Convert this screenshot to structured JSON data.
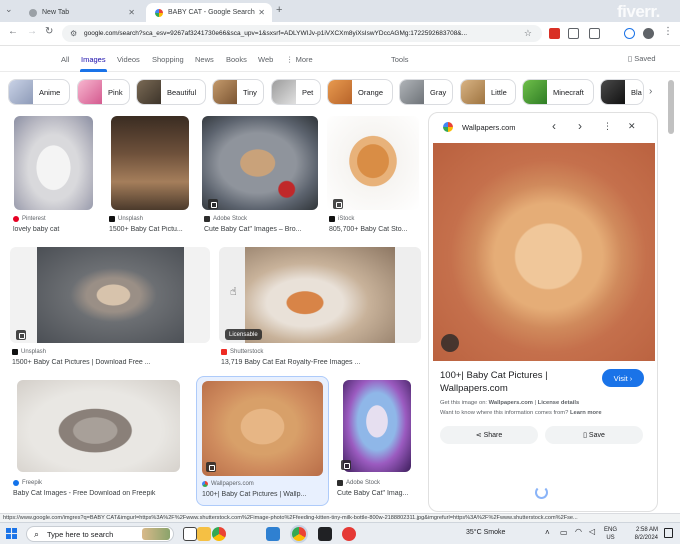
{
  "browser": {
    "tabs": [
      {
        "title": "New Tab",
        "active": false
      },
      {
        "title": "BABY CAT - Google Search",
        "active": true
      }
    ],
    "url": "google.com/search?sca_esv=9267af3241730e66&sca_upv=1&sxsrf=ADLYWIJv-p1iVXCXm8yiXsIswYDccAGMg:1722592683708&...",
    "watermark": "fiverr."
  },
  "google_nav": {
    "tabs": [
      "All",
      "Images",
      "Videos",
      "Shopping",
      "News",
      "Books",
      "Web",
      "More"
    ],
    "tools": "Tools",
    "saved": "Saved"
  },
  "chips": [
    "Anime",
    "Pink",
    "Beautiful",
    "Tiny",
    "Pet",
    "Orange",
    "Gray",
    "Little",
    "Minecraft",
    "Bla"
  ],
  "results": [
    {
      "source": "Pinterest",
      "caption": "lovely baby cat"
    },
    {
      "source": "Unsplash",
      "caption": "1500+ Baby Cat Pictu..."
    },
    {
      "source": "Adobe Stock",
      "caption": "Cute Baby Cat\" Images – Bro..."
    },
    {
      "source": "iStock",
      "caption": "805,700+ Baby Cat Sto..."
    },
    {
      "source": "Unsplash",
      "caption": "1500+ Baby Cat Pictures | Download Free ..."
    },
    {
      "source": "Shutterstock",
      "caption": "13,719 Baby Cat Eat Royalty-Free Images ...",
      "label": "Licensable"
    },
    {
      "source": "Freepik",
      "caption": "Baby Cat Images - Free Download on Freepik"
    },
    {
      "source": "Wallpapers.com",
      "caption": "100+| Baby Cat Pictures | Wallp..."
    },
    {
      "source": "Adobe Stock",
      "caption": "Cute Baby Cat\" Imag..."
    }
  ],
  "panel": {
    "site": "Wallpapers.com",
    "title": "100+| Baby Cat Pictures | Wallpapers.com",
    "visit": "Visit",
    "info_prefix": "Get this image on:",
    "info_site": "Wallpapers.com",
    "info_sep": " | ",
    "license": "License details",
    "want_text": "Want to know where this information comes from?",
    "learn_more": "Learn more",
    "share": "Share",
    "save": "Save"
  },
  "status_url": "https://www.google.com/imgres?q=BABY CAT&imgurl=https%3A%2F%2Fwww.shutterstock.com%2Fimage-photo%2Ffeeding-kitten-tiny-milk-bottle-800w-2188802311.jpg&imgrefurl=https%3A%2F%2Fwww.shutterstock.com%2Fse...",
  "taskbar": {
    "search_placeholder": "Type here to search",
    "weather": "35°C  Smoke",
    "lang1": "ENG",
    "lang2": "US",
    "time": "2:58 AM",
    "date": "8/2/2024"
  },
  "colors": {
    "accent": "#1a73e8",
    "link": "#1a0dab",
    "tabbar": "#dee3ea"
  }
}
